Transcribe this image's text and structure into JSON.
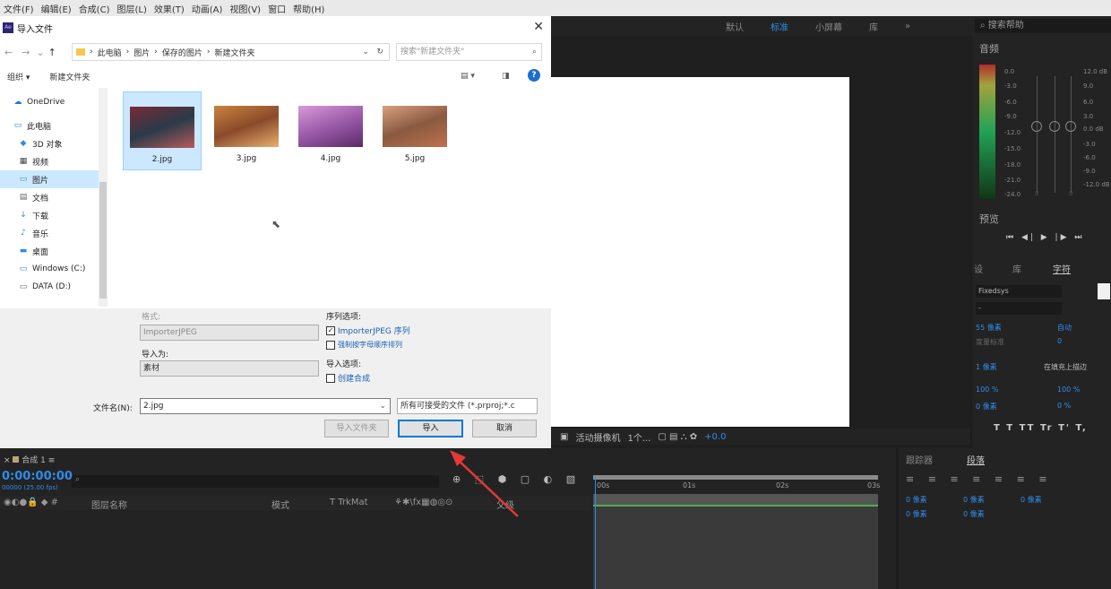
{
  "menubar": [
    "文件(F)",
    "编辑(E)",
    "合成(C)",
    "图层(L)",
    "效果(T)",
    "动画(A)",
    "视图(V)",
    "窗口",
    "帮助(H)"
  ],
  "workspace": {
    "tabs": [
      "默认",
      "标准",
      "小屏幕",
      "库"
    ],
    "active": "标准",
    "more": "»",
    "search": "搜索帮助"
  },
  "audio": {
    "title": "音频",
    "left_db": [
      "0.0",
      "-3.0",
      "-6.0",
      "-9.0",
      "-12.0",
      "-15.0",
      "-18.0",
      "-21.0",
      "-24.0"
    ],
    "right_db": [
      "12.0 dB",
      "9.0",
      "6.0",
      "3.0",
      "0.0 dB",
      "-3.0",
      "-6.0",
      "-9.0",
      "-12.0 dB"
    ],
    "bottom_vals": [
      "0",
      "0"
    ]
  },
  "preview": {
    "title": "预览",
    "controls": "⏮ ◀| ▶ |▶ ⏭"
  },
  "character": {
    "tabs": [
      "设",
      "库",
      "字符"
    ],
    "font": "Fixedsys",
    "style": "-",
    "size": "55 像素",
    "leading": "自动",
    "tracking": "度量标准",
    "kerning": "0",
    "stroke": "1 像素",
    "stroke_type": "在填充上描边",
    "v_scale": "100 %",
    "h_scale": "100 %",
    "baseline": "0 像素",
    "tsume": "0 %",
    "formats": "T T TT Tr T' T,"
  },
  "viewer_toolbar": {
    "camera": "活动摄像机",
    "views": "1个...",
    "exposure": "+0.0"
  },
  "timeline": {
    "tab": "合成 1",
    "timecode": "0:00:00:00",
    "sub": "00000 (25.00 fps)",
    "col_layer": "图层名称",
    "col_mode": "模式",
    "col_trk": "T  TrkMat",
    "col_parent": "父级",
    "ruler": [
      "00s",
      "01s",
      "02s",
      "03s"
    ]
  },
  "paragraph": {
    "tabs": [
      "跟踪器",
      "段落"
    ],
    "vals": [
      "0 像素",
      "0 像素",
      "0 像素",
      "0 像素",
      "0 像素"
    ]
  },
  "dialog": {
    "title": "导入文件",
    "breadcrumb": [
      "此电脑",
      "图片",
      "保存的图片",
      "新建文件夹"
    ],
    "search_placeholder": "搜索\"新建文件夹\"",
    "organize": "组织 ▾",
    "new_folder": "新建文件夹",
    "nav": [
      {
        "label": "OneDrive",
        "icon": "☁"
      },
      {
        "label": "此电脑",
        "icon": "🖥"
      },
      {
        "label": "3D 对象",
        "icon": "◆"
      },
      {
        "label": "视频",
        "icon": "▦"
      },
      {
        "label": "图片",
        "icon": "▭"
      },
      {
        "label": "文档",
        "icon": "▤"
      },
      {
        "label": "下载",
        "icon": "↓"
      },
      {
        "label": "音乐",
        "icon": "♪"
      },
      {
        "label": "桌面",
        "icon": "▬"
      },
      {
        "label": "Windows (C:)",
        "icon": "▭"
      },
      {
        "label": "DATA (D:)",
        "icon": "▭"
      }
    ],
    "files": [
      {
        "name": "2.jpg",
        "colors": [
          "#7a2a34",
          "#2a3a4a",
          "#b65a5a"
        ]
      },
      {
        "name": "3.jpg",
        "colors": [
          "#c8843e",
          "#8a4a2a",
          "#e8b070"
        ]
      },
      {
        "name": "4.jpg",
        "colors": [
          "#d89ad8",
          "#9a5aa8",
          "#5a2a6a"
        ]
      },
      {
        "name": "5.jpg",
        "colors": [
          "#d8a080",
          "#8a5a40",
          "#c07050"
        ]
      }
    ],
    "format_label": "格式:",
    "format_value": "ImporterJPEG",
    "import_as_label": "导入为:",
    "import_as_value": "素材",
    "sequence_label": "序列选项:",
    "seq_importer": "ImporterJPEG 序列",
    "force_alpha": "强制按字母顺序排列",
    "import_options_label": "导入选项:",
    "create_comp": "创建合成",
    "filename_label": "文件名(N):",
    "filename_value": "2.jpg",
    "filter_value": "所有可接受的文件 (*.prproj;*.c",
    "import_folder": "导入文件夹",
    "import_btn": "导入",
    "cancel_btn": "取消"
  }
}
